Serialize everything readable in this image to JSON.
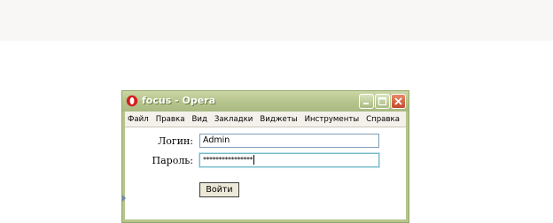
{
  "window": {
    "title": "focus - Opera",
    "app_icon": "opera-icon",
    "controls": {
      "minimize": "minimize-icon",
      "maximize": "maximize-icon",
      "close": "close-icon"
    }
  },
  "menu": {
    "items": [
      "Файл",
      "Правка",
      "Вид",
      "Закладки",
      "Виджеты",
      "Инструменты",
      "Справка"
    ]
  },
  "form": {
    "login_label": "Логин:",
    "login_value": "Admin",
    "password_label": "Пароль:",
    "password_value": "****************",
    "submit_label": "Войти"
  },
  "colors": {
    "titlebar": "#b8c68f",
    "close_button": "#c4472a",
    "field_border": "#7f9db9",
    "focus_border": "#79b9c8"
  }
}
